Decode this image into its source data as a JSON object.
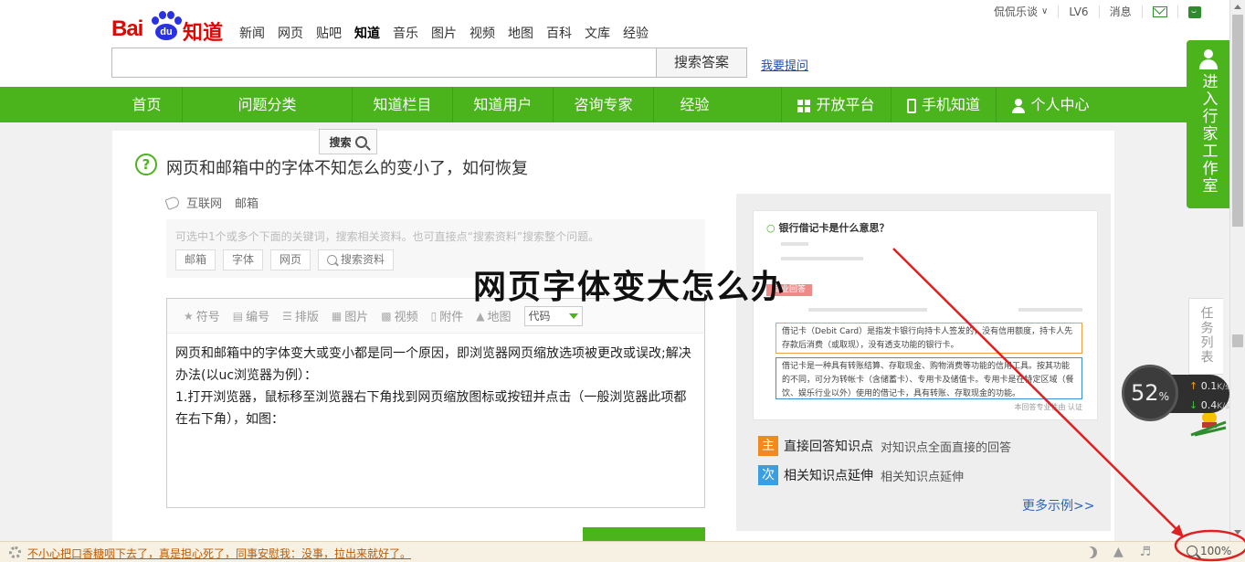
{
  "header": {
    "logo_text": "Bai du 知道",
    "logo_pad": "du",
    "categories": [
      "新闻",
      "网页",
      "贴吧",
      "知道",
      "音乐",
      "图片",
      "视频",
      "地图",
      "百科",
      "文库",
      "经验"
    ],
    "active_category": "知道",
    "user": {
      "name": "侃侃乐谈",
      "level": "LV6",
      "messages": "消息"
    },
    "search": {
      "value": "",
      "button": "搜索答案",
      "ask_link": "我要提问"
    }
  },
  "nav": {
    "items": [
      "首页",
      "问题分类",
      "知道栏目",
      "知道用户",
      "咨询专家",
      "经验"
    ],
    "right": [
      "开放平台",
      "手机知道",
      "个人中心"
    ],
    "accent": "#4bb31b"
  },
  "question": {
    "search_tooltip": "搜索",
    "title": "网页和邮箱中的字体不知怎么的变小了，如何恢复",
    "tags": [
      "互联网",
      "邮箱"
    ],
    "hint": "可选中1个或多个下面的关键词，搜索相关资料。也可直接点“搜索资料”搜索整个问题。",
    "keywords": [
      "邮箱",
      "字体",
      "网页"
    ],
    "search_material": "搜索资料"
  },
  "editor": {
    "toolbar": [
      "符号",
      "编号",
      "排版",
      "图片",
      "视频",
      "附件",
      "地图"
    ],
    "code_select": "代码",
    "body": [
      "网页和邮箱中的字体变大或变小都是同一个原因，即浏览器网页缩放选项被更改或误改;解决办法(以uc浏览器为例）：",
      "1.打开浏览器，鼠标移至浏览器右下角找到网页缩放图标或按钮并点击（一般浏览器此项都在右下角），如图："
    ]
  },
  "ad": {
    "shot_title": "银行借记卡是什么意思？",
    "shot_tag": "专业回答",
    "shot_box1": "借记卡（Debit Card）是指发卡银行向持卡人签发的，没有信用额度，持卡人先存款后消费（或取现），没有透支功能的银行卡。",
    "shot_box2": "借记卡是一种具有转账结算、存取现金、购物消费等功能的信用工具。按其功能的不同，可分为转帐卡（含储蓄卡）、专用卡及储值卡。专用卡是在特定区域（餐饮、娱乐行业以外）使用的借记卡，具有转账、存取现金的功能。",
    "shot_verified": "本回答专业性由 认证",
    "features": [
      {
        "badge": "主",
        "title": "直接回答知识点",
        "desc": "对知识点全面直接的回答",
        "color": "#f08a1e"
      },
      {
        "badge": "次",
        "title": "相关知识点延伸",
        "desc": "相关知识点延伸",
        "color": "#3a9ee0"
      }
    ],
    "more": "更多示例>>"
  },
  "headline": "网页字体变大怎么办",
  "side": {
    "studio": "进入行家工作室",
    "task": "任务列表",
    "speed": {
      "percent": "52",
      "percent_unit": "%",
      "up": "0.1",
      "down": "0.4",
      "unit": "K/s"
    }
  },
  "status_bar": {
    "ticker": "不小心把口香糖咽下去了，真是担心死了，同事安慰我：没事，拉出来就好了。",
    "zoom": "100%"
  }
}
